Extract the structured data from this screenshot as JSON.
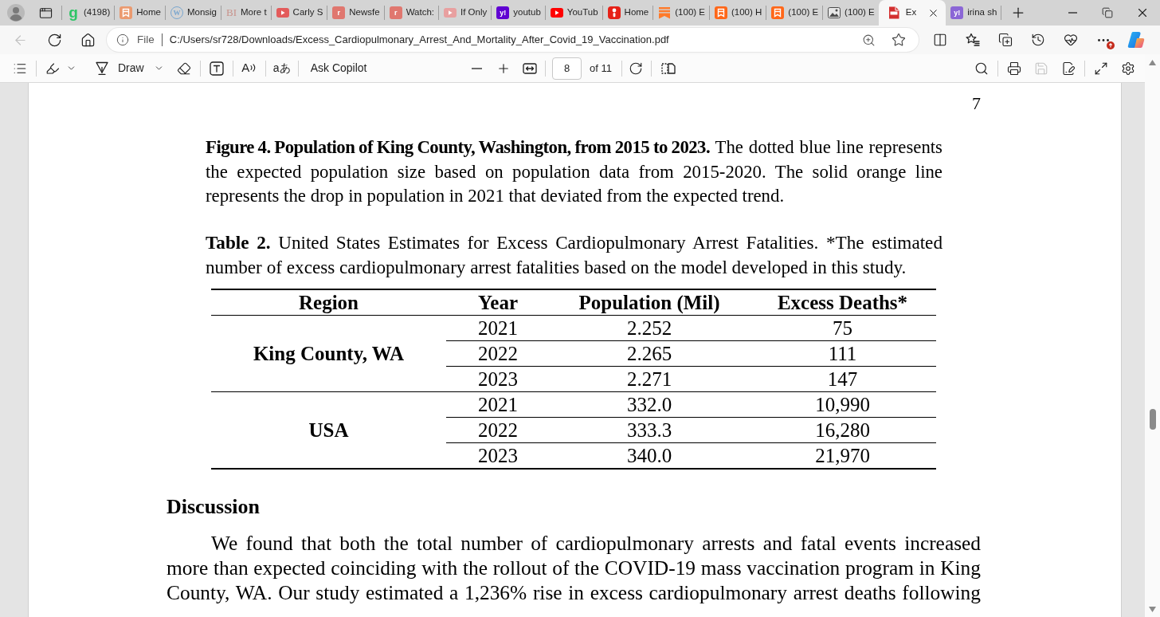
{
  "window": {
    "tabs": [
      {
        "label": "(4198)",
        "selected": false,
        "favicon": {
          "kind": "letter",
          "glyph": "g",
          "color": "#2ec566"
        }
      },
      {
        "label": "Home",
        "selected": false,
        "favicon": {
          "kind": "bookmark",
          "color": "#eb9a6f"
        }
      },
      {
        "label": "Monsig",
        "selected": false,
        "favicon": {
          "kind": "ring",
          "glyph": "W",
          "color": "#79a6cf"
        }
      },
      {
        "label": "More t",
        "selected": false,
        "favicon": {
          "kind": "serif",
          "glyph": "BI",
          "color": "#c8928a"
        }
      },
      {
        "label": "Carly S",
        "selected": false,
        "favicon": {
          "kind": "play",
          "color": "#e35b5b"
        }
      },
      {
        "label": "Newsfe",
        "selected": false,
        "favicon": {
          "kind": "tile",
          "glyph": "r",
          "color": "#e0776f"
        }
      },
      {
        "label": "Watch:",
        "selected": false,
        "favicon": {
          "kind": "tile",
          "glyph": "r",
          "color": "#e0776f"
        }
      },
      {
        "label": "If Only",
        "selected": false,
        "favicon": {
          "kind": "play",
          "color": "#e8a0a0"
        }
      },
      {
        "label": "youtub",
        "selected": false,
        "favicon": {
          "kind": "tile",
          "glyph": "y!",
          "color": "#6001d2"
        }
      },
      {
        "label": "YouTub",
        "selected": false,
        "favicon": {
          "kind": "play",
          "color": "#ff0000"
        }
      },
      {
        "label": "Home",
        "selected": false,
        "favicon": {
          "kind": "app",
          "color": "#e62117"
        }
      },
      {
        "label": "(100) E",
        "selected": false,
        "favicon": {
          "kind": "ribbon",
          "color": "#ff7a2a"
        }
      },
      {
        "label": "(100) H",
        "selected": false,
        "favicon": {
          "kind": "bookmark",
          "color": "#ff6719"
        }
      },
      {
        "label": "(100) E",
        "selected": false,
        "favicon": {
          "kind": "bookmark",
          "color": "#ff6719"
        }
      },
      {
        "label": "(100) E",
        "selected": false,
        "favicon": {
          "kind": "photo",
          "color": "#4a4a4a"
        }
      },
      {
        "label": "Ex",
        "selected": true,
        "favicon": {
          "kind": "pdf",
          "color": "#d32f2f"
        }
      },
      {
        "label": "irina sh",
        "selected": false,
        "favicon": {
          "kind": "tile",
          "glyph": "y!",
          "color": "#8b66d6"
        }
      }
    ]
  },
  "address_bar": {
    "back": {
      "disabled": true
    },
    "scheme": "File",
    "url": "C:/Users/sr728/Downloads/Excess_Cardiopulmonary_Arrest_And_Mortality_After_Covid_19_Vaccination.pdf"
  },
  "pdf_toolbar": {
    "draw_label": "Draw",
    "read_aloud_glyph": "A",
    "translate_glyph": "aあ",
    "copilot_label": "Ask Copilot",
    "page": {
      "current": "8",
      "total": "of 11"
    },
    "save": {
      "disabled": true
    }
  },
  "document": {
    "page_number": "7",
    "figure_caption": "**Figure 4. Population of King County, Washington, from 2015 to 2023.** The dotted blue line represents the expected population size based on population data from 2015-2020. The solid orange line represents the drop in population in 2021 that deviated from the expected trend.",
    "table_caption": "**Table 2.** United States Estimates for Excess Cardiopulmonary Arrest Fatalities. *The estimated number of excess cardiopulmonary arrest fatalities based on the model developed in this study.",
    "table": {
      "columns": [
        "Region",
        "Year",
        "Population (Mil)",
        "Excess Deaths*"
      ],
      "groups": [
        {
          "region": "King County, WA",
          "rows": [
            [
              "2021",
              "2.252",
              "75"
            ],
            [
              "2022",
              "2.265",
              "111"
            ],
            [
              "2023",
              "2.271",
              "147"
            ]
          ]
        },
        {
          "region": "USA",
          "rows": [
            [
              "2021",
              "332.0",
              "10,990"
            ],
            [
              "2022",
              "333.3",
              "16,280"
            ],
            [
              "2023",
              "340.0",
              "21,970"
            ]
          ]
        }
      ]
    },
    "discussion": {
      "heading": "Discussion",
      "paragraph": "We found that both the total number of cardiopulmonary arrests and fatal events increased more than expected coinciding with the rollout of the COVID-19 mass vaccination program in King County, WA. Our study estimated a 1,236% rise in excess cardiopulmonary arrest deaths following"
    }
  }
}
